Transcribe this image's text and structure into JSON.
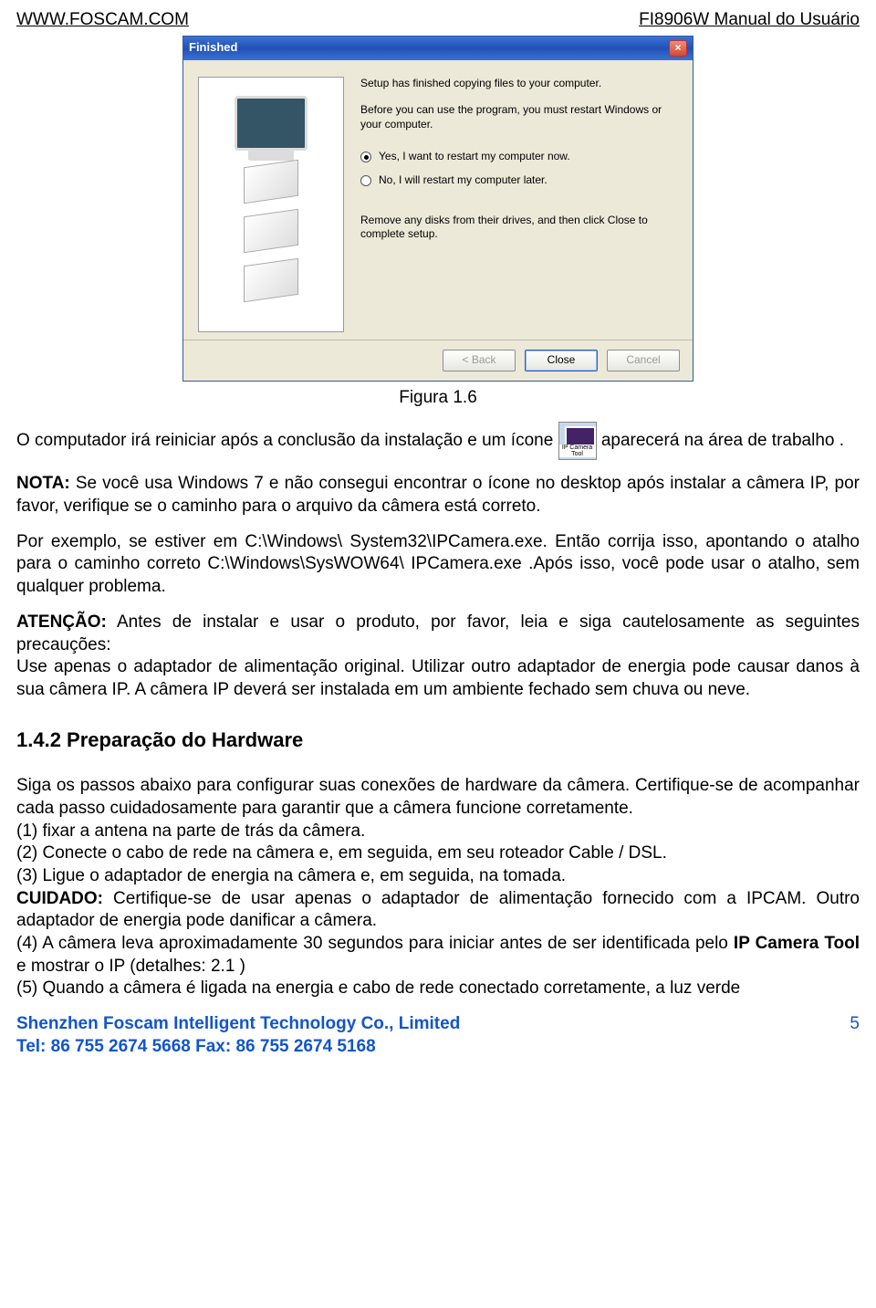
{
  "header": {
    "left": "WWW.FOSCAM.COM",
    "right": "FI8906W Manual do Usuário"
  },
  "dialog": {
    "title": "Finished",
    "line1": "Setup has finished copying files to your computer.",
    "line2": "Before you can use the program, you must restart Windows or your computer.",
    "radio_yes": "Yes, I want to restart my computer now.",
    "radio_no": "No, I will restart my computer later.",
    "remove_note": "Remove any disks from their drives, and then click Close to complete setup.",
    "btn_back": "< Back",
    "btn_close": "Close",
    "btn_cancel": "Cancel"
  },
  "caption": "Figura 1.6",
  "body": {
    "p1a": "O computador irá reiniciar após a conclusão da instalação e um ícone ",
    "p1b": "aparecerá na área de trabalho .",
    "icon_label": "IP Camera Tool",
    "nota_label": "NOTA:",
    "nota": " Se você usa Windows 7 e não consegui encontrar o ícone no desktop após instalar a câmera IP, por favor, verifique se o caminho para o arquivo da câmera está correto.",
    "p3": "Por exemplo, se estiver em C:\\Windows\\ System32\\IPCamera.exe. Então corrija isso, apontando o atalho para o caminho correto C:\\Windows\\SysWOW64\\ IPCamera.exe .Após isso, você pode usar o atalho, sem qualquer problema.",
    "atencao_label": "ATENÇÃO:",
    "p4": " Antes de instalar e usar o produto, por favor, leia e siga cautelosamente as seguintes precauções:",
    "p5": "Use apenas o adaptador de alimentação original. Utilizar outro adaptador de energia pode causar danos à sua câmera IP. A câmera IP deverá ser instalada em um ambiente fechado sem chuva ou neve.",
    "heading": "1.4.2 Preparação do Hardware",
    "h1": "Siga os passos abaixo para configurar suas conexões de hardware da câmera. Certifique-se de acompanhar cada passo cuidadosamente para garantir que a câmera funcione corretamente.",
    "h2": "(1) fixar a antena na parte de trás da câmera.",
    "h3": "(2) Conecte o cabo de rede na câmera e, em seguida, em seu roteador Cable / DSL.",
    "h4": "(3) Ligue o adaptador de energia na câmera e, em seguida, na tomada.",
    "cuidado_label": "CUIDADO:",
    "h5": " Certifique-se de usar apenas o adaptador de alimentação fornecido com a IPCAM. Outro adaptador de energia pode danificar a câmera.",
    "h6a": "(4) A câmera leva aproximadamente 30 segundos para iniciar antes de ser identificada pelo ",
    "h6b": "IP Camera Tool",
    "h6c": " e mostrar o IP (detalhes: 2.1 )",
    "h7": "(5) Quando a câmera é ligada na energia e cabo de rede conectado corretamente, a luz verde"
  },
  "footer": {
    "company": "Shenzhen Foscam Intelligent Technology Co., Limited",
    "tel": "Tel: 86 755 2674 5668 Fax: 86 755 2674 5168",
    "page": "5"
  }
}
